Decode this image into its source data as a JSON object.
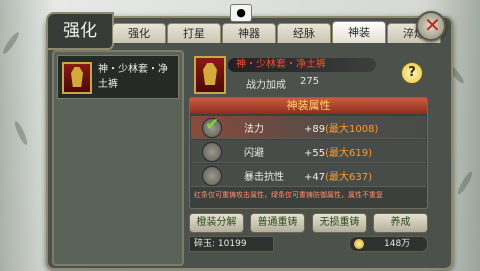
{
  "title": "强化",
  "tabs": [
    "强化",
    "打星",
    "神器",
    "经脉",
    "神装",
    "淬炼"
  ],
  "active_tab": "神装",
  "list": {
    "items": [
      {
        "name": "神・少林套・净土裤"
      }
    ]
  },
  "equip": {
    "name": "神・少林套・净土裤",
    "power_label": "战力加成",
    "power_value": "275"
  },
  "attributes": {
    "header": "神装属性",
    "rows": [
      {
        "name": "法力",
        "value": "+89",
        "max": "(最大1008)",
        "selected": true
      },
      {
        "name": "闪避",
        "value": "+55",
        "max": "(最大619)",
        "selected": false
      },
      {
        "name": "暴击抗性",
        "value": "+47",
        "max": "(最大637)",
        "selected": false
      }
    ],
    "note": "红条仅可重铸攻击属性，绿条仅可重铸防御属性，属性不重复"
  },
  "buttons": {
    "decompose": "橙装分解",
    "normal_recast": "普通重铸",
    "lossless_recast": "无损重铸",
    "nurture": "养成"
  },
  "resources": {
    "jade_label": "碎玉:",
    "jade_value": "10199",
    "coins_value": "148万"
  },
  "colors": {
    "equip_name": "#ff4a2a",
    "max_value": "#ff9a2a",
    "section_header": "#ffd56a"
  },
  "icons": [
    "camera-icon",
    "close-icon",
    "help-icon",
    "checkmark-icon",
    "coin-icon",
    "robe-icon"
  ]
}
